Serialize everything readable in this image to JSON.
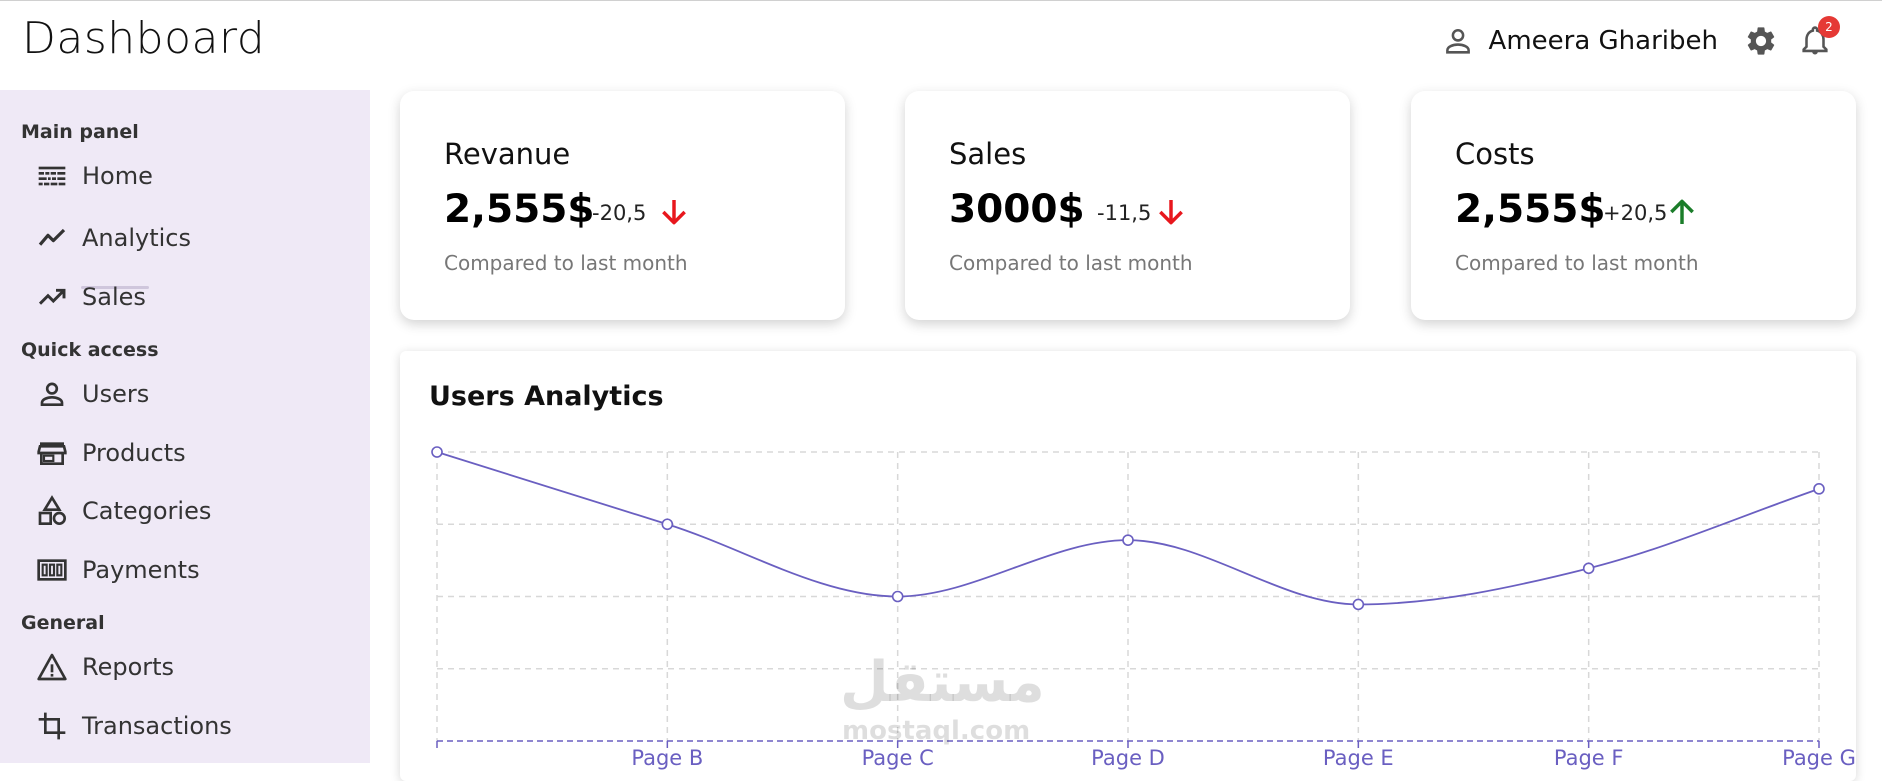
{
  "header": {
    "title": "Dashboard",
    "user_name": "Ameera Gharibeh",
    "notification_count": "2",
    "icons": [
      "user-icon",
      "gear-icon",
      "bell-icon"
    ]
  },
  "sidebar": {
    "sections": [
      {
        "title": "Main panel",
        "items": [
          {
            "label": "Home",
            "icon": "home-icon",
            "active": true
          },
          {
            "label": "Analytics",
            "icon": "analytics-icon"
          },
          {
            "label": "Sales",
            "icon": "trending-up-icon"
          }
        ]
      },
      {
        "title": "Quick access",
        "items": [
          {
            "label": "Users",
            "icon": "user-icon"
          },
          {
            "label": "Products",
            "icon": "store-icon"
          },
          {
            "label": "Categories",
            "icon": "category-icon"
          },
          {
            "label": "Payments",
            "icon": "payments-icon"
          }
        ]
      },
      {
        "title": "General",
        "items": [
          {
            "label": "Reports",
            "icon": "warning-icon"
          },
          {
            "label": "Transactions",
            "icon": "crop-icon"
          }
        ]
      }
    ]
  },
  "cards": [
    {
      "title": "Revanue",
      "value": "2,555$",
      "change": "-20,5",
      "direction": "down",
      "subtitle": "Compared to last month"
    },
    {
      "title": "Sales",
      "value": "3000$",
      "change": "-11,5",
      "direction": "down",
      "subtitle": "Compared to last month"
    },
    {
      "title": "Costs",
      "value": "2,555$",
      "change": "+20,5",
      "direction": "up",
      "subtitle": "Compared to last month"
    }
  ],
  "colors": {
    "down": "#e8171d",
    "up": "#1b7d2a",
    "line": "#6a5fc1",
    "sidebar_bg": "#efe9f6"
  },
  "chart_data": {
    "type": "line",
    "title": "Users Analytics",
    "categories": [
      "",
      "Page B",
      "Page C",
      "Page D",
      "Page E",
      "Page F",
      "Page G"
    ],
    "series": [
      {
        "values": [
          4000,
          3000,
          2000,
          2780,
          1890,
          2390,
          3490
        ]
      }
    ],
    "ylim": [
      0,
      4000
    ],
    "grid": true,
    "curve": "smooth"
  },
  "watermark": {
    "arabic": "مستقل",
    "latin": "mostaql.com"
  }
}
